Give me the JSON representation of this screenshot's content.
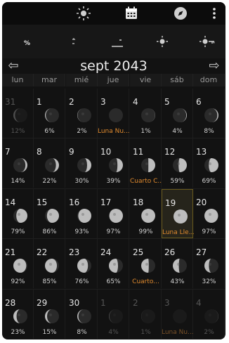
{
  "month_title": "sept 2043",
  "nav": {
    "prev_icon": "arrow-left-icon",
    "next_icon": "arrow-right-icon"
  },
  "top_tabs": [
    {
      "icon": "moon-icon"
    },
    {
      "icon": "sun-icon"
    },
    {
      "icon": "calendar-icon",
      "active": true
    },
    {
      "icon": "compass-icon"
    },
    {
      "icon": "more-vert-icon"
    }
  ],
  "sub_tabs": [
    {
      "icon": "moon-percent-icon",
      "active": true
    },
    {
      "icon": "moon-cycle-icon"
    },
    {
      "icon": "moonrise-icon"
    },
    {
      "icon": "sun-rise-icon"
    },
    {
      "icon": "sun-key-icon"
    }
  ],
  "weekdays": [
    "lun",
    "mar",
    "mié",
    "jue",
    "vie",
    "sáb",
    "dom"
  ],
  "days": [
    {
      "day": "31",
      "label": "12%",
      "other": true,
      "illum": 0.12,
      "waxing": false
    },
    {
      "day": "1",
      "label": "6%",
      "illum": 0.06,
      "waxing": false
    },
    {
      "day": "2",
      "label": "2%",
      "illum": 0.02,
      "waxing": false
    },
    {
      "day": "3",
      "label": "Luna Nu...",
      "event": true,
      "illum": 0.0,
      "waxing": true
    },
    {
      "day": "4",
      "label": "1%",
      "illum": 0.01,
      "waxing": true
    },
    {
      "day": "5",
      "label": "4%",
      "illum": 0.04,
      "waxing": true
    },
    {
      "day": "6",
      "label": "8%",
      "illum": 0.08,
      "waxing": true
    },
    {
      "day": "7",
      "label": "14%",
      "illum": 0.14,
      "waxing": true
    },
    {
      "day": "8",
      "label": "22%",
      "illum": 0.22,
      "waxing": true
    },
    {
      "day": "9",
      "label": "30%",
      "illum": 0.3,
      "waxing": true
    },
    {
      "day": "10",
      "label": "39%",
      "illum": 0.39,
      "waxing": true
    },
    {
      "day": "11",
      "label": "Cuarto C...",
      "event": true,
      "illum": 0.49,
      "waxing": true
    },
    {
      "day": "12",
      "label": "59%",
      "illum": 0.59,
      "waxing": true
    },
    {
      "day": "13",
      "label": "69%",
      "illum": 0.69,
      "waxing": true
    },
    {
      "day": "14",
      "label": "79%",
      "illum": 0.79,
      "waxing": true
    },
    {
      "day": "15",
      "label": "86%",
      "illum": 0.86,
      "waxing": true
    },
    {
      "day": "16",
      "label": "93%",
      "illum": 0.93,
      "waxing": true
    },
    {
      "day": "17",
      "label": "97%",
      "illum": 0.97,
      "waxing": true
    },
    {
      "day": "18",
      "label": "99%",
      "illum": 0.99,
      "waxing": true
    },
    {
      "day": "19",
      "label": "Luna Lle...",
      "event": true,
      "today": true,
      "illum": 1.0,
      "waxing": true
    },
    {
      "day": "20",
      "label": "97%",
      "illum": 0.97,
      "waxing": false
    },
    {
      "day": "21",
      "label": "92%",
      "illum": 0.92,
      "waxing": false
    },
    {
      "day": "22",
      "label": "85%",
      "illum": 0.85,
      "waxing": false
    },
    {
      "day": "23",
      "label": "76%",
      "illum": 0.76,
      "waxing": false
    },
    {
      "day": "24",
      "label": "65%",
      "illum": 0.65,
      "waxing": false
    },
    {
      "day": "25",
      "label": "Cuarto...",
      "event": true,
      "illum": 0.54,
      "waxing": false
    },
    {
      "day": "26",
      "label": "43%",
      "illum": 0.43,
      "waxing": false
    },
    {
      "day": "27",
      "label": "32%",
      "illum": 0.32,
      "waxing": false
    },
    {
      "day": "28",
      "label": "23%",
      "illum": 0.23,
      "waxing": false
    },
    {
      "day": "29",
      "label": "15%",
      "illum": 0.15,
      "waxing": false
    },
    {
      "day": "30",
      "label": "8%",
      "illum": 0.08,
      "waxing": false
    },
    {
      "day": "1",
      "label": "4%",
      "other": true,
      "illum": 0.04,
      "waxing": false
    },
    {
      "day": "2",
      "label": "1%",
      "other": true,
      "illum": 0.01,
      "waxing": false
    },
    {
      "day": "3",
      "label": "Luna Nu...",
      "event": true,
      "other": true,
      "illum": 0.0,
      "waxing": true
    },
    {
      "day": "4",
      "label": "2%",
      "other": true,
      "illum": 0.02,
      "waxing": true
    }
  ]
}
